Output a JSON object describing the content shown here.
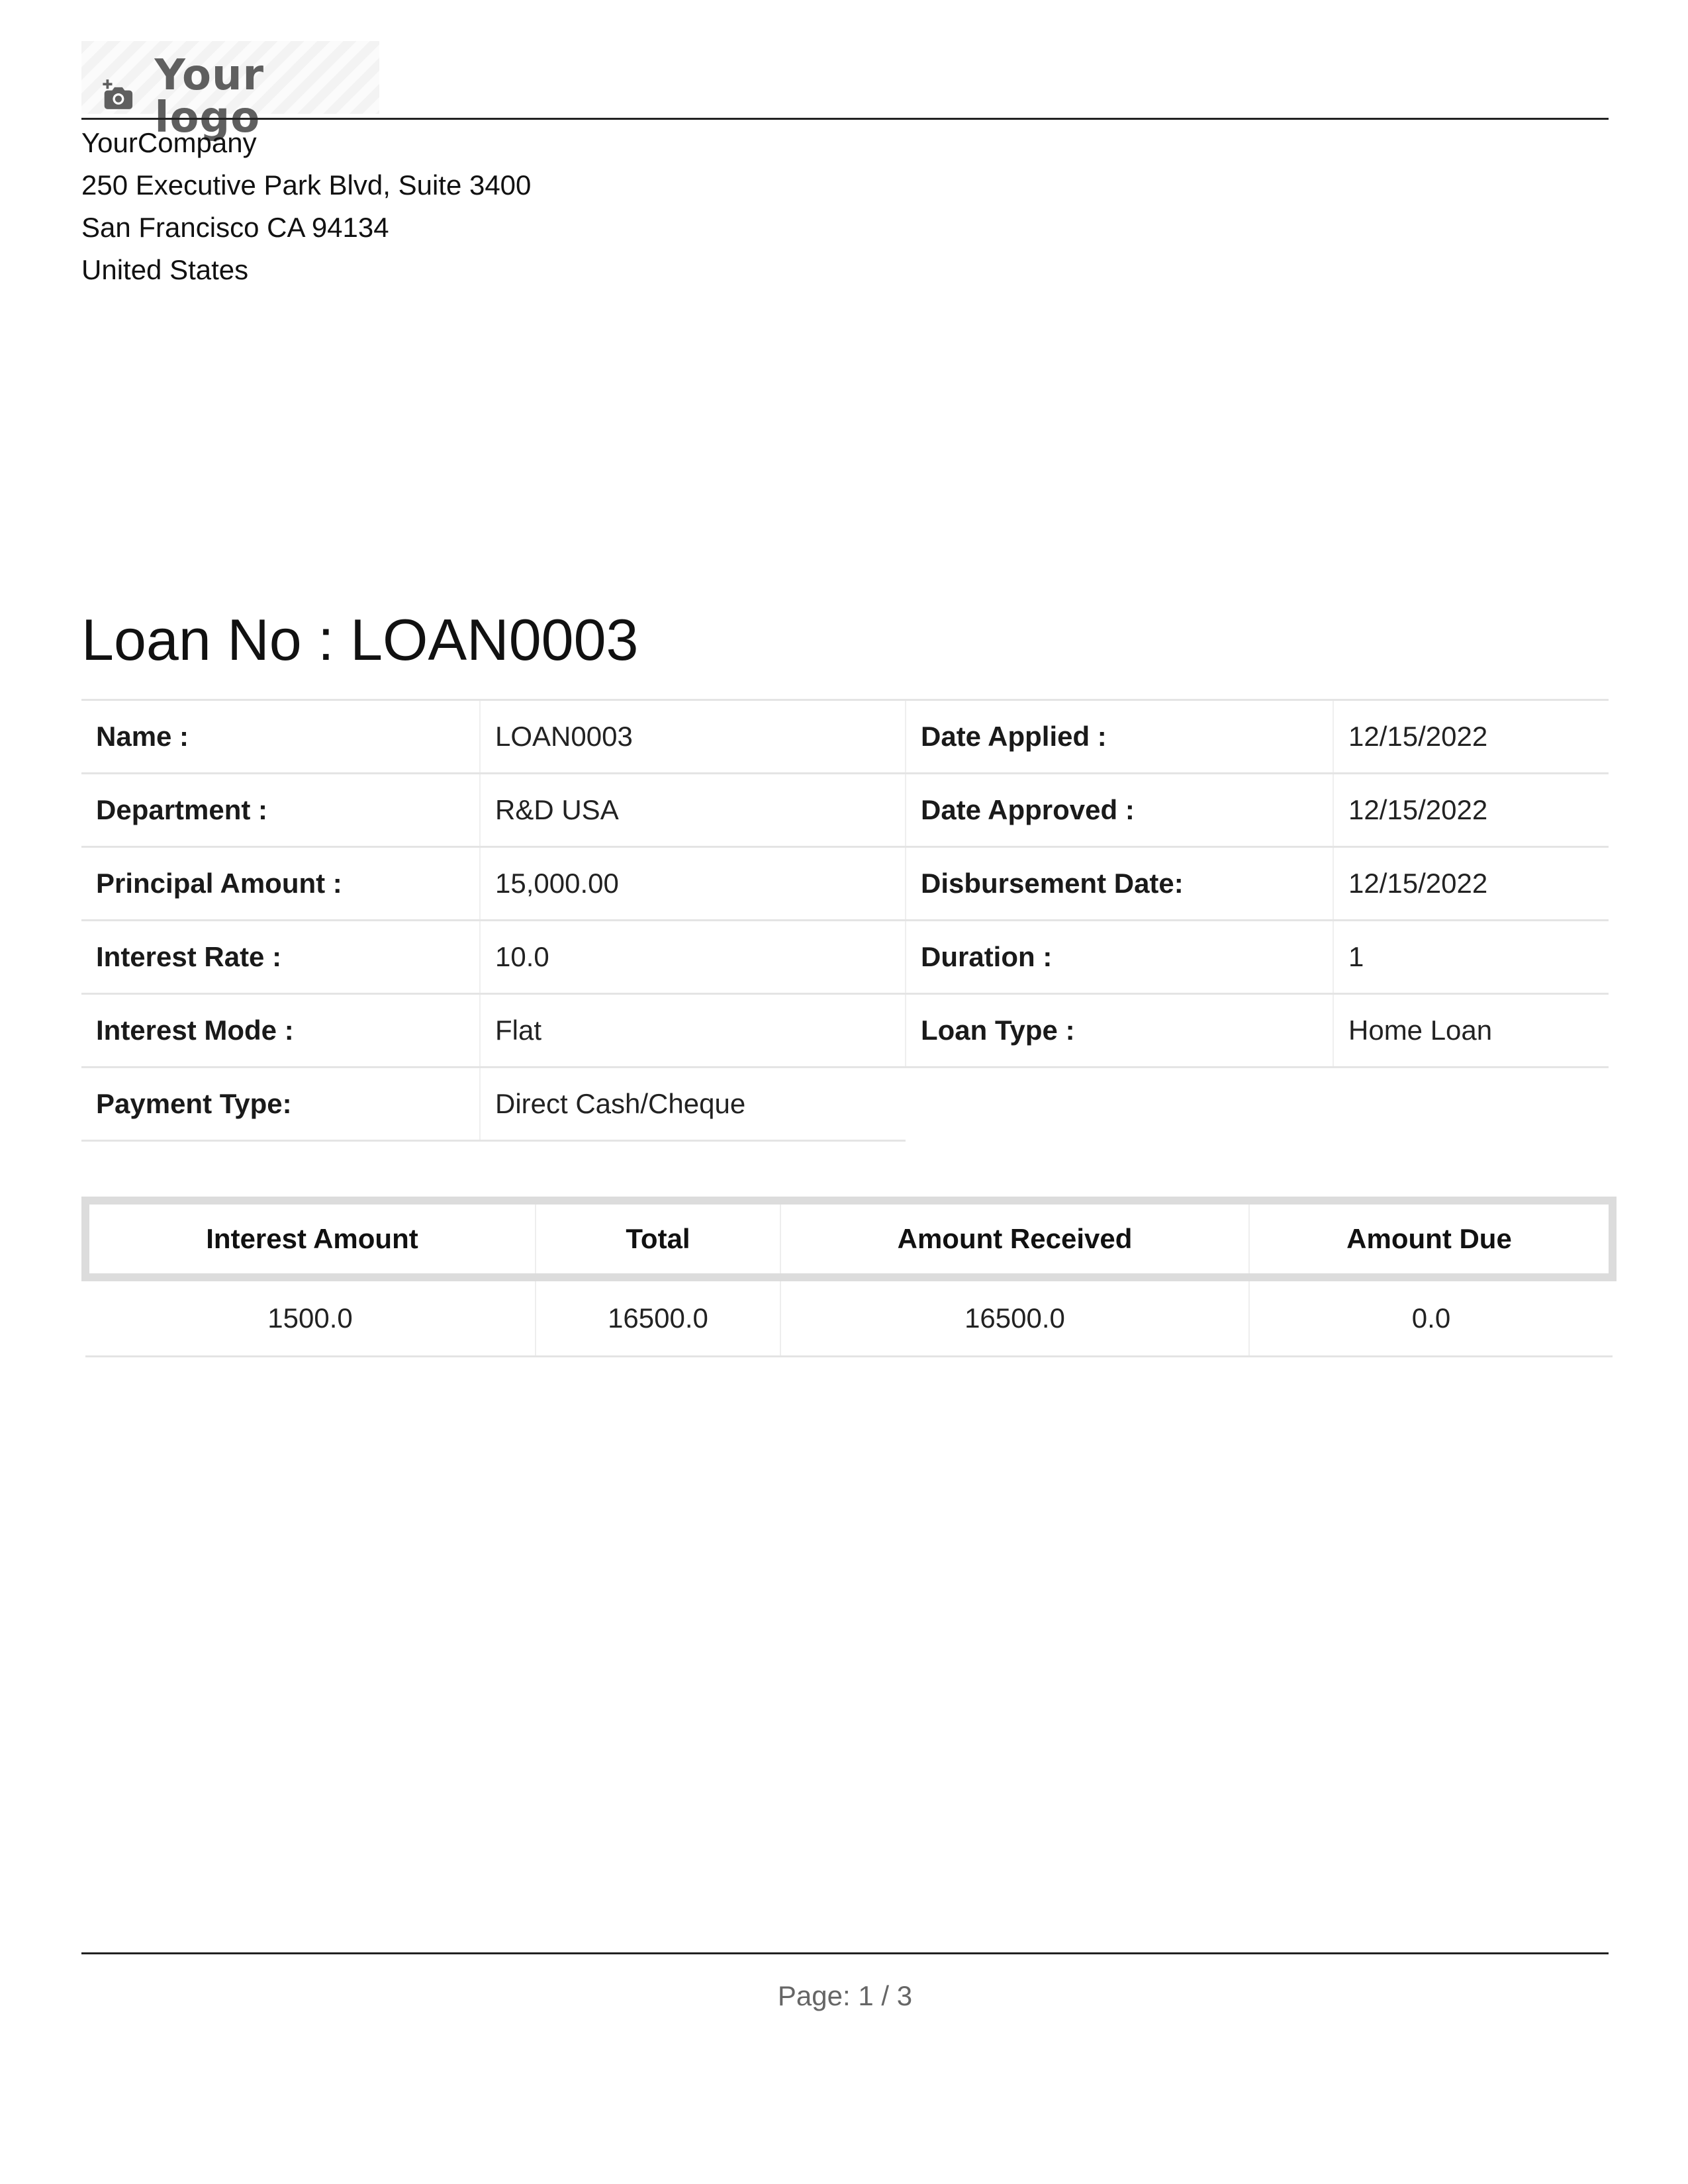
{
  "header": {
    "logo_text": "Your logo",
    "logo_icon": "camera-plus-icon",
    "company": {
      "name": "YourCompany",
      "street": "250 Executive Park Blvd, Suite 3400",
      "city": "San Francisco CA 94134",
      "country": "United States"
    }
  },
  "document": {
    "title_label": "Loan No : ",
    "title_value": "LOAN0003"
  },
  "details": {
    "name_label": "Name :",
    "name_value": "LOAN0003",
    "date_applied_label": "Date Applied :",
    "date_applied_value": "12/15/2022",
    "department_label": "Department :",
    "department_value": "R&D USA",
    "date_approved_label": "Date Approved :",
    "date_approved_value": "12/15/2022",
    "principal_label": "Principal Amount :",
    "principal_value": "15,000.00",
    "disbursement_label": "Disbursement Date:",
    "disbursement_value": "12/15/2022",
    "interest_rate_label": "Interest Rate :",
    "interest_rate_value": "10.0",
    "duration_label": "Duration :",
    "duration_value": "1",
    "interest_mode_label": "Interest Mode :",
    "interest_mode_value": "Flat",
    "loan_type_label": "Loan Type :",
    "loan_type_value": "Home Loan",
    "payment_type_label": "Payment Type:",
    "payment_type_value": "Direct Cash/Cheque"
  },
  "summary": {
    "headers": [
      "Interest Amount",
      "Total",
      "Amount Received",
      "Amount Due"
    ],
    "row": [
      "1500.0",
      "16500.0",
      "16500.0",
      "0.0"
    ]
  },
  "footer": {
    "page_label": "Page: 1 / 3"
  }
}
